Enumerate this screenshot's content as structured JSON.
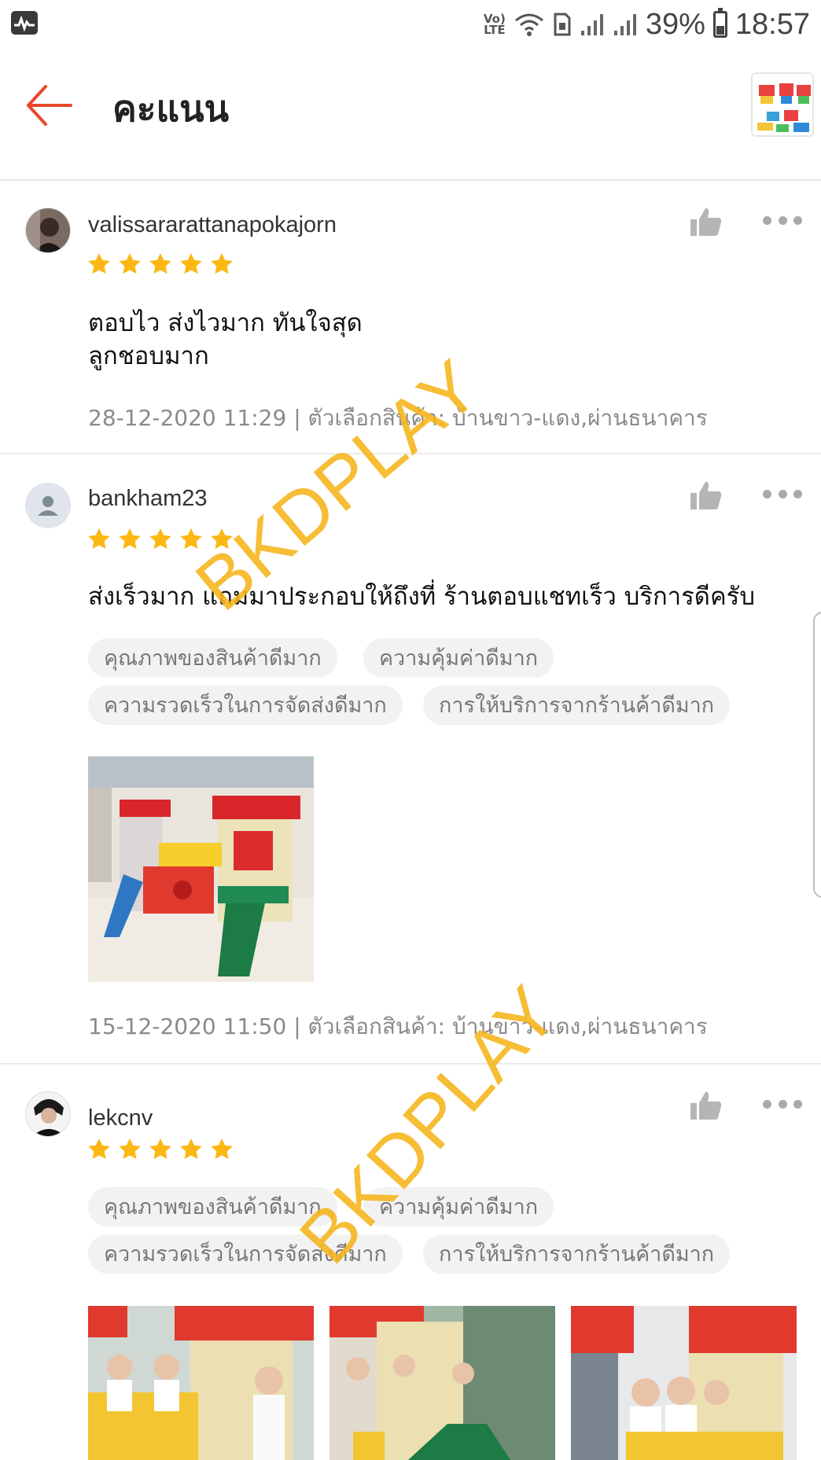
{
  "status_bar": {
    "volte_line1": "Vo)",
    "volte_line2": "LTE",
    "battery_percent": "39%",
    "time": "18:57"
  },
  "header": {
    "title": "คะแนน",
    "back_icon": "arrow-left-icon",
    "accent_color": "#e8472b"
  },
  "reviews": [
    {
      "username": "valissararattanapokajorn",
      "rating": 5,
      "comment_line1": "ตอบไว ส่งไวมาก ทันใจสุด",
      "comment_line2": "ลูกชอบมาก",
      "meta": "28-12-2020 11:29 | ตัวเลือกสินค้า: บ้านขาว-แดง,ผ่านธนาคาร"
    },
    {
      "username": "bankham23",
      "rating": 5,
      "comment": "ส่งเร็วมาก แถมมาประกอบให้ถึงที่ ร้านตอบแชทเร็ว บริการดีครับ",
      "tags": [
        "คุณภาพของสินค้าดีมาก",
        "ความคุ้มค่าดีมาก",
        "ความรวดเร็วในการจัดส่งดีมาก",
        "การให้บริการจากร้านค้าดีมาก"
      ],
      "meta": "15-12-2020 11:50 | ตัวเลือกสินค้า: บ้านขาว-แดง,ผ่านธนาคาร"
    },
    {
      "username": "lekcnv",
      "rating": 5,
      "tags": [
        "คุณภาพของสินค้าดีมาก",
        "ความคุ้มค่าดีมาก",
        "ความรวดเร็วในการจัดส่งดีมาก",
        "การให้บริการจากร้านค้าดีมาก"
      ]
    }
  ],
  "watermark": "BKDPLAY",
  "star_color": "#fcb713"
}
